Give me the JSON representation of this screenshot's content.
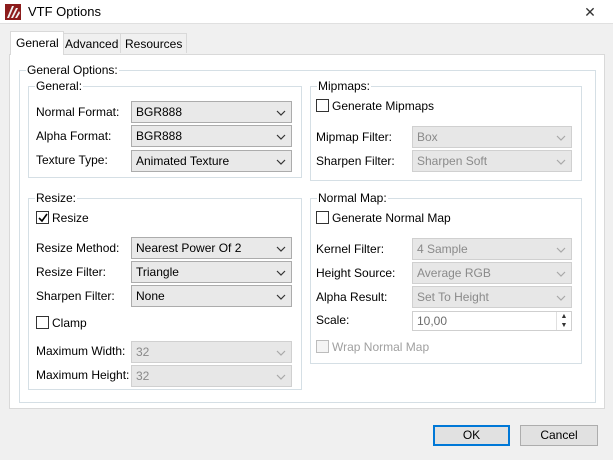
{
  "window": {
    "title": "VTF Options",
    "close_glyph": "✕"
  },
  "tabs": [
    {
      "label": "General",
      "active": true
    },
    {
      "label": "Advanced",
      "active": false
    },
    {
      "label": "Resources",
      "active": false
    }
  ],
  "general_options": {
    "label": "General Options:",
    "general": {
      "label": "General:",
      "normal_format": {
        "label": "Normal Format:",
        "value": "BGR888"
      },
      "alpha_format": {
        "label": "Alpha Format:",
        "value": "BGR888"
      },
      "texture_type": {
        "label": "Texture Type:",
        "value": "Animated Texture"
      }
    },
    "mipmaps": {
      "label": "Mipmaps:",
      "generate": {
        "label": "Generate Mipmaps",
        "checked": false
      },
      "filter": {
        "label": "Mipmap Filter:",
        "value": "Box"
      },
      "sharpen": {
        "label": "Sharpen Filter:",
        "value": "Sharpen Soft"
      }
    },
    "resize": {
      "label": "Resize:",
      "resize_check": {
        "label": "Resize",
        "checked": true
      },
      "method": {
        "label": "Resize Method:",
        "value": "Nearest Power Of 2"
      },
      "filter": {
        "label": "Resize Filter:",
        "value": "Triangle"
      },
      "sharpen": {
        "label": "Sharpen Filter:",
        "value": "None"
      },
      "clamp": {
        "label": "Clamp",
        "checked": false
      },
      "max_width": {
        "label": "Maximum Width:",
        "value": "32"
      },
      "max_height": {
        "label": "Maximum Height:",
        "value": "32"
      }
    },
    "normal_map": {
      "label": "Normal Map:",
      "generate": {
        "label": "Generate Normal Map",
        "checked": false
      },
      "kernel": {
        "label": "Kernel Filter:",
        "value": "4 Sample"
      },
      "height_source": {
        "label": "Height Source:",
        "value": "Average RGB"
      },
      "alpha_result": {
        "label": "Alpha Result:",
        "value": "Set To Height"
      },
      "scale": {
        "label": "Scale:",
        "value": "10,00"
      },
      "wrap": {
        "label": "Wrap Normal Map",
        "checked": false
      }
    }
  },
  "buttons": {
    "ok": "OK",
    "cancel": "Cancel"
  },
  "colors": {
    "accent": "#0078d7",
    "app_icon": "#8c1c1c",
    "group_border": "#d5dfe5"
  },
  "icons": {
    "app": "vtf-app-icon",
    "dropdown": "chevron-down-icon",
    "check": "checkmark-icon"
  }
}
